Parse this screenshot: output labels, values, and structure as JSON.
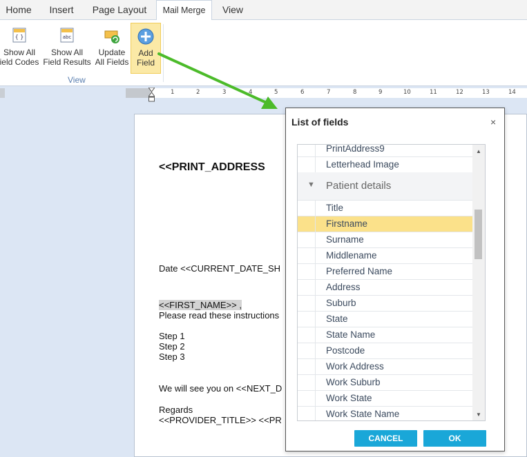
{
  "tabs": [
    {
      "label": "Home"
    },
    {
      "label": "Insert"
    },
    {
      "label": "Page Layout"
    },
    {
      "label": "Mail Merge"
    },
    {
      "label": "View"
    }
  ],
  "ribbon": {
    "buttons": {
      "show_codes": {
        "line1": "Show All",
        "line2": "ield Codes",
        "icon": "field-codes-icon"
      },
      "show_results": {
        "line1": "Show All",
        "line2": "Field Results",
        "icon": "field-results-icon"
      },
      "update": {
        "line1": "Update",
        "line2": "All Fields",
        "icon": "update-fields-icon"
      },
      "add": {
        "line1": "Add",
        "line2": "Field",
        "icon": "add-field-icon"
      }
    },
    "group_label": "View"
  },
  "ruler": {
    "labels": [
      "1",
      "2",
      "3",
      "4",
      "5",
      "6",
      "7",
      "8",
      "9",
      "10",
      "11",
      "12",
      "13",
      "14"
    ]
  },
  "document": {
    "title": "<<PRINT_ADDRESS",
    "date_line": "Date  <<CURRENT_DATE_SH",
    "first_name": "<<FIRST_NAME>> ,",
    "instructions": "Please read these instructions",
    "steps": [
      "Step 1",
      "Step 2",
      "Step 3"
    ],
    "next_line": "We will see you on <<NEXT_D",
    "regards": "Regards",
    "provider": "<<PROVIDER_TITLE>> <<PR"
  },
  "dialog": {
    "title": "List of fields",
    "close": "×",
    "rows_before": [
      "PrintAddress9",
      "Letterhead Image"
    ],
    "group": "Patient details",
    "rows_after": [
      "Title",
      "Firstname",
      "Surname",
      "Middlename",
      "Preferred Name",
      "Address",
      "Suburb",
      "State",
      "State Name",
      "Postcode",
      "Work Address",
      "Work Suburb",
      "Work State",
      "Work State Name"
    ],
    "selected": "Firstname",
    "cancel": "CANCEL",
    "ok": "OK"
  },
  "colors": {
    "accent_button": "#1aa7d8",
    "selection": "#fbe18a",
    "arrow": "#4cbb2a"
  }
}
